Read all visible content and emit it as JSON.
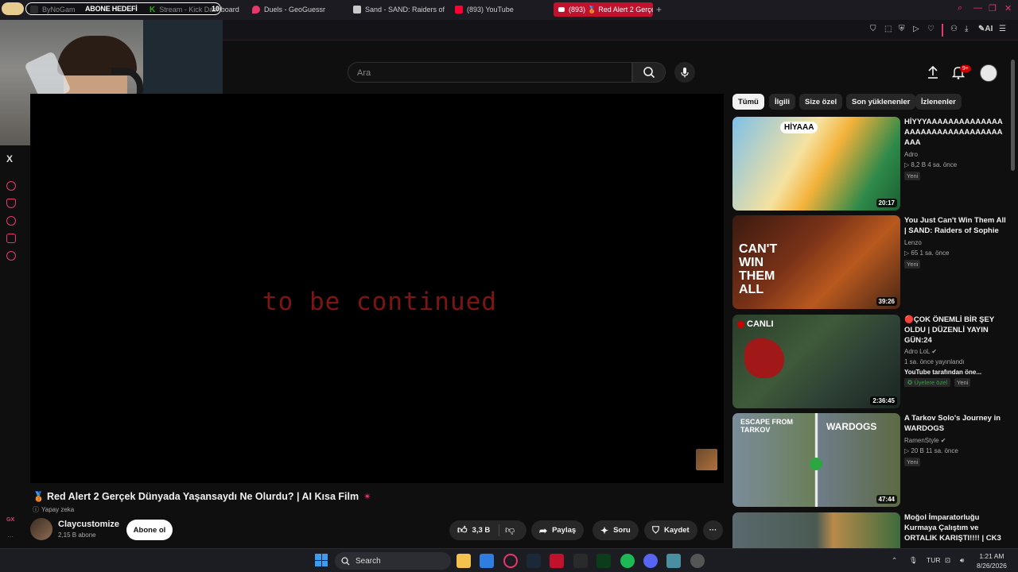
{
  "browser": {
    "tabs": [
      {
        "label": "ByNoGam"
      },
      {
        "label": "Stream - Kick Dashboard"
      },
      {
        "label": "Duels - GeoGuessr"
      },
      {
        "label": "Sand - SAND: Raiders of S..."
      },
      {
        "label": "(893) YouTube"
      },
      {
        "label": "(893) 🥉 Red Alert 2 Gerçe"
      }
    ],
    "new_tab": "+",
    "ai_label": "AI"
  },
  "stream_overlay": {
    "label": "ABONE HEDEFİ",
    "count": "10"
  },
  "sidebar": {
    "x_label": "X",
    "gx_label": "GX",
    "more": "···"
  },
  "header": {
    "search_placeholder": "Ara",
    "notif_count": "9+"
  },
  "player": {
    "overlay_text": "to be continued"
  },
  "video": {
    "medal": "🥉",
    "title": "Red Alert 2 Gerçek Dünyada Yaşansaydı Ne Olurdu? | AI Kısa Film",
    "star": "✴",
    "ai_tag": "Yapay zeka",
    "channel": "Claycustomize",
    "subs": "2,15 B abone",
    "subscribe": "Abone ol",
    "likes": "3,3 B",
    "share": "Paylaş",
    "ask": "Soru",
    "save": "Kaydet",
    "more": "···"
  },
  "chips": [
    "Tümü",
    "İlgili",
    "Size özel",
    "Son yüklenenler",
    "İzlenenler"
  ],
  "recs": [
    {
      "title": "HİYYYAAAAAAAAAAAAAAAAAAAAAAAAAAAAAAAAAAA",
      "channel": "Adro",
      "meta": "▷ 8,2 B   4 sa. önce",
      "badge": "Yeni",
      "duration": "20:17"
    },
    {
      "title": "You Just Can't Win Them All | SAND: Raiders of Sophie",
      "channel": "Lenzo",
      "meta": "▷ 65   1 sa. önce",
      "badge": "Yeni",
      "duration": "39:26",
      "thumb_text": "CAN'T WIN THEM ALL"
    },
    {
      "title": "🔴ÇOK ÖNEMLİ BİR ŞEY OLDU | DÜZENLİ YAYIN GÜN:24",
      "channel": "Adro LoL ✔",
      "meta": "1 sa. önce yayınlandı",
      "extra": "YouTube tarafından öne...",
      "members": "✪ Üyelere özel",
      "badge": "Yeni",
      "duration": "2:36:45",
      "live": "CANLI"
    },
    {
      "title": "A Tarkov Solo's Journey in WARDOGS",
      "channel": "RamenStyle ✔",
      "meta": "▷ 20 B   11 sa. önce",
      "badge": "Yeni",
      "duration": "47:44",
      "thumb_left": "ESCAPE FROM TARKOV",
      "thumb_right": "WARDOGS"
    },
    {
      "title": "Moğol İmparatorluğu Kurmaya Çalıştım ve ORTALIK KARIŞTI!!!! | CK3 ..."
    }
  ],
  "taskbar": {
    "search": "Search",
    "lang": "TUR",
    "time": "1:21 AM",
    "date": "8/26/2026"
  },
  "colors": {
    "accent": "#e8376b",
    "yt_red": "#cc0000",
    "overlay_red": "#7e1414"
  }
}
